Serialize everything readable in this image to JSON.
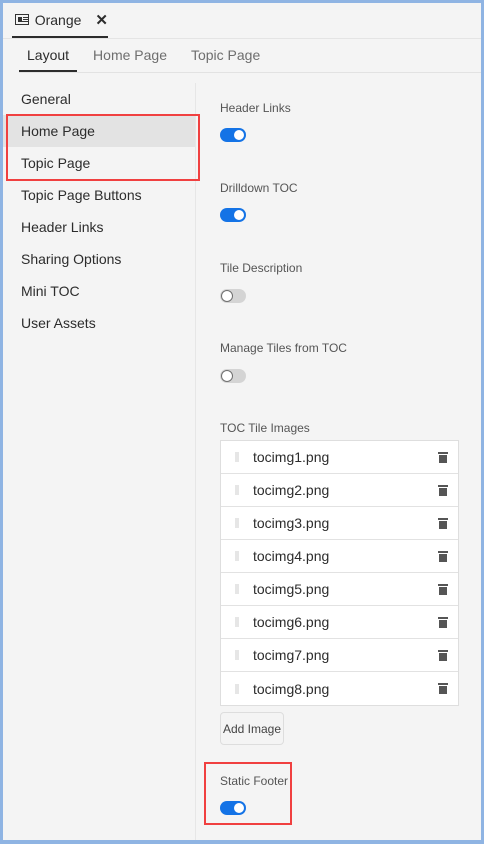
{
  "document_tab": {
    "title": "Orange",
    "close": "✕"
  },
  "subtabs": [
    "Layout",
    "Home Page",
    "Topic Page"
  ],
  "sidebar": [
    "General",
    "Home Page",
    "Topic Page",
    "Topic Page Buttons",
    "Header Links",
    "Sharing Options",
    "Mini TOC",
    "User Assets"
  ],
  "settings": [
    {
      "label": "Header Links",
      "on": true
    },
    {
      "label": "Drilldown TOC",
      "on": true
    },
    {
      "label": "Tile Description",
      "on": false
    },
    {
      "label": "Manage Tiles from TOC",
      "on": false
    }
  ],
  "toc_images": {
    "label": "TOC Tile Images",
    "files": [
      "tocimg1.png",
      "tocimg2.png",
      "tocimg3.png",
      "tocimg4.png",
      "tocimg5.png",
      "tocimg6.png",
      "tocimg7.png",
      "tocimg8.png"
    ],
    "add_label": "Add Image"
  },
  "static_footer": {
    "label": "Static Footer",
    "on": true
  },
  "colors": {
    "accent": "#1473e6",
    "highlight": "#f04040",
    "border": "#8fb4e3"
  }
}
